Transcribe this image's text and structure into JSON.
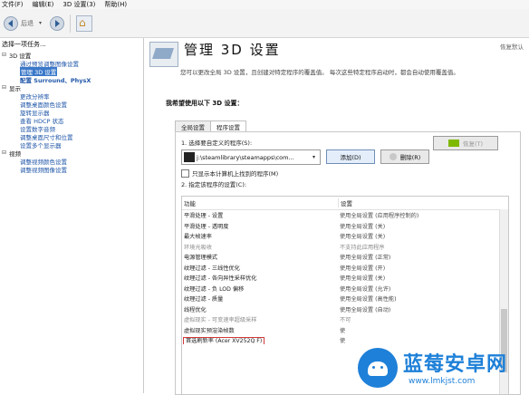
{
  "menubar": {
    "items": [
      "文件(F)",
      "编辑(E)",
      "3D 设置(3)",
      "帮助(H)"
    ]
  },
  "toolbar": {
    "back_label": "后退",
    "home_icon": "home-icon"
  },
  "sidebar": {
    "header": "选择一项任务...",
    "categories": [
      {
        "label": "3D 设置",
        "items": [
          {
            "label": "通过预览调整图像设置",
            "selected": false,
            "bold": false
          },
          {
            "label": "管理 3D 设置",
            "selected": true,
            "bold": false
          },
          {
            "label": "配置 Surround、PhysX",
            "selected": false,
            "bold": true
          }
        ]
      },
      {
        "label": "显示",
        "items": [
          {
            "label": "更改分辨率",
            "selected": false,
            "bold": false
          },
          {
            "label": "调整桌面颜色设置",
            "selected": false,
            "bold": false
          },
          {
            "label": "旋转显示器",
            "selected": false,
            "bold": false
          },
          {
            "label": "查看 HDCP 状态",
            "selected": false,
            "bold": false
          },
          {
            "label": "设置数字音频",
            "selected": false,
            "bold": false
          },
          {
            "label": "调整桌面尺寸和位置",
            "selected": false,
            "bold": false
          },
          {
            "label": "设置多个显示器",
            "selected": false,
            "bold": false
          }
        ]
      },
      {
        "label": "视频",
        "items": [
          {
            "label": "调整视频颜色设置",
            "selected": false,
            "bold": false
          },
          {
            "label": "调整视频图像设置",
            "selected": false,
            "bold": false
          }
        ]
      }
    ]
  },
  "main": {
    "title": "管理 3D 设置",
    "restore_defaults": "恢复默认",
    "description": "您可以更改全局 3D 设置，且创建对特定程序的覆盖值。 每次这些特定程序启动时，都会自动使用覆盖值。",
    "section_heading": "我希望使用以下 3D 设置：",
    "tabs": [
      {
        "label": "全局设置",
        "active": false
      },
      {
        "label": "程序设置",
        "active": true
      }
    ],
    "step1_label": "1. 选择要自定义的程序(S):",
    "program_value": "j:\\steamlibrary\\steamapps\\com...",
    "add_button": "添加(D)",
    "remove_button": "删除(R)",
    "restore_button": "恢复(T)",
    "checkbox_label": "只显示本计算机上找到的程序(M)",
    "step2_label": "2. 指定该程序的设置(C):",
    "table": {
      "col_feature": "功能",
      "col_setting": "设置",
      "rows": [
        {
          "feature": "平滑处理 - 设置",
          "setting": "使用全局设置 (应用程序控制的)",
          "gray": false,
          "highlight": false
        },
        {
          "feature": "平滑处理 - 透明度",
          "setting": "使用全局设置 (关)",
          "gray": false,
          "highlight": false
        },
        {
          "feature": "最大帧速率",
          "setting": "使用全局设置 (关)",
          "gray": false,
          "highlight": false
        },
        {
          "feature": "环境光吸收",
          "setting": "不支持此应用程序",
          "gray": true,
          "highlight": false
        },
        {
          "feature": "电源管理模式",
          "setting": "使用全局设置 (正常)",
          "gray": false,
          "highlight": false
        },
        {
          "feature": "纹理过滤 - 三线性优化",
          "setting": "使用全局设置 (开)",
          "gray": false,
          "highlight": false
        },
        {
          "feature": "纹理过滤 - 各向异性采样优化",
          "setting": "使用全局设置 (关)",
          "gray": false,
          "highlight": false
        },
        {
          "feature": "纹理过滤 - 负 LOD 偏移",
          "setting": "使用全局设置 (允许)",
          "gray": false,
          "highlight": false
        },
        {
          "feature": "纹理过滤 - 质量",
          "setting": "使用全局设置 (高性能)",
          "gray": false,
          "highlight": false
        },
        {
          "feature": "线程优化",
          "setting": "使用全局设置 (自动)",
          "gray": false,
          "highlight": false
        },
        {
          "feature": "虚拟现实 - 可变速率超级采样",
          "setting": "不可",
          "gray": true,
          "highlight": false
        },
        {
          "feature": "虚拟现实预渲染帧数",
          "setting": "使",
          "gray": false,
          "highlight": false
        },
        {
          "feature": "首选刷新率 (Acer XV252Q F)",
          "setting": "使",
          "gray": false,
          "highlight": true
        }
      ]
    }
  },
  "watermark": {
    "title": "蓝莓安卓网",
    "url": "www.lmkjst.com"
  }
}
